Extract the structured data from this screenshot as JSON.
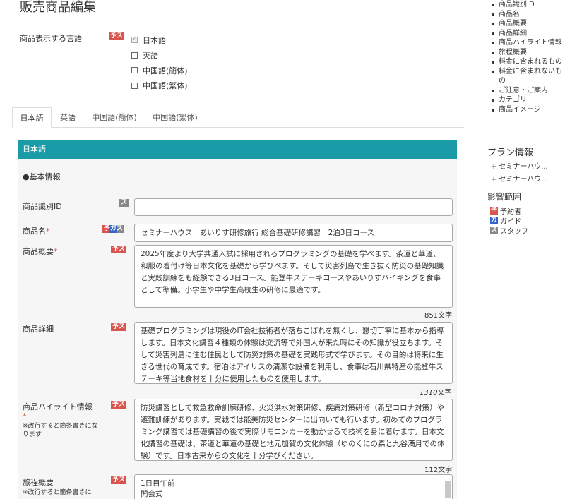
{
  "page": {
    "title": "販売商品編集"
  },
  "language": {
    "label": "商品表示する言語",
    "badge": "予ス",
    "options": [
      {
        "label": "日本語",
        "checked": true
      },
      {
        "label": "英語",
        "checked": false
      },
      {
        "label": "中国語(簡体)",
        "checked": false
      },
      {
        "label": "中国語(繁体)",
        "checked": false
      }
    ]
  },
  "tabs": [
    "日本語",
    "英語",
    "中国語(簡体)",
    "中国語(繁体)"
  ],
  "panel": {
    "header": "日本語",
    "section_title": "●基本情報",
    "fields": {
      "product_id": {
        "label": "商品識別ID",
        "badge": "ス",
        "value": ""
      },
      "product_name": {
        "label": "商品名",
        "required": "*",
        "badge": "予ガス",
        "value": "セミナーハウス　あいりす研修旅行 総合基礎研修講習　2泊3日コース"
      },
      "summary": {
        "label": "商品概要",
        "required": "*",
        "badge": "予ス",
        "value": "2025年度より大学共通入試に採用されるプログラミングの基礎を学べます。茶道と華道、和服の着付け等日本文化を基礎から学びべます。そして災害列島で生き抜く防災の基礎知識と実践訓練をも経験できる3日コース。能登牛ステーキコースやあいりすバイキングを食事として準備。小学生や中学生高校生の研修に最適です。",
        "count": "851文字"
      },
      "detail": {
        "label": "商品詳細",
        "badge": "予ス",
        "value": "基礎プログラミングは現役のIT会社技術者が落ちこぼれを無くし、懇切丁寧に基本から指導します。日本文化講習４種類の体験は交流等で外国人が来た時にその知識が役立ちます。そして災害列島に住む住民として防災対策の基礎を実践形式で学びます。その目的は将来に生きる世代の育成です。宿泊はアイリスの清潔な設備を利用し、食事は石川県特産の能登牛ステーキ等当地食材を十分に使用したものを使用します。",
        "count_num": "1310",
        "count_unit": "文字"
      },
      "highlight": {
        "label": "商品ハイライト情報",
        "required": "*",
        "note": "※改行すると箇条書きになります",
        "badge": "予ス",
        "value": "防災講習として救急救命訓練研修、火災洪水対策研修、疾病対策研修（新型コロナ対策）や避難訓練があります。実戦では能美防災センターに出向いても行います。初めてのプログラミング講習では基礎講習の後で実際リモコンカーを動かせるで技術を身に着けます。日本文化講習の基礎は、茶道と華道の基礎と地元加賀の文化体験（ゆのくにの森と九谷満月での体験）です。日本古来からの文化を十分学びください。",
        "count": "112文字"
      },
      "itinerary": {
        "label": "旅程概要",
        "note": "※改行すると箇条書きに",
        "badge": "予ス",
        "lines": [
          "1日目午前",
          "開会式"
        ]
      }
    }
  },
  "sidebar": {
    "toc": [
      "商品識別ID",
      "商品名",
      "商品概要",
      "商品詳細",
      "商品ハイライト情報",
      "旅程概要",
      "料金に含まれるもの",
      "料金に含まれないもの",
      "ご注意・ご案内",
      "カテゴリ",
      "商品イメージ"
    ],
    "plan_title": "プラン情報",
    "plan_items": [
      "セミナーハウ...",
      "セミナーハウ..."
    ],
    "impact_title": "影響範囲",
    "impact_items": [
      {
        "badge": "予",
        "label": "予約者",
        "color": "#d9534f"
      },
      {
        "badge": "ガ",
        "label": "ガイド",
        "color": "#3366cc"
      },
      {
        "badge": "ス",
        "label": "スタッフ",
        "color": "#888888"
      }
    ]
  }
}
